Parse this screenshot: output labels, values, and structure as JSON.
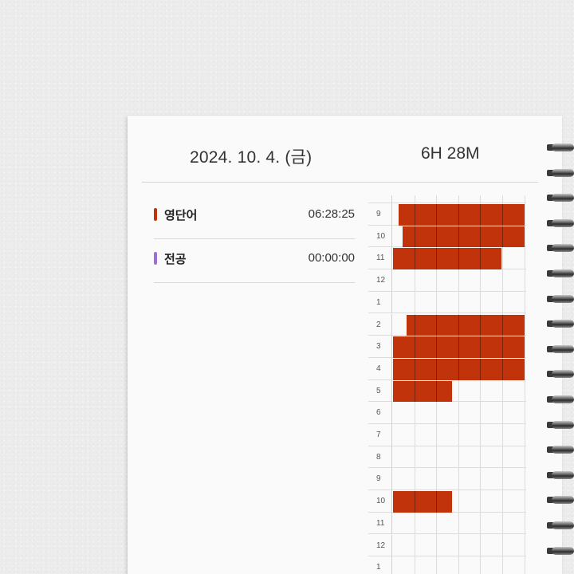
{
  "header": {
    "date": "2024. 10. 4. (금)",
    "total": "6H 28M"
  },
  "subjects": [
    {
      "name": "영단어",
      "time": "06:28:25",
      "color": "#c1340b"
    },
    {
      "name": "전공",
      "time": "00:00:00",
      "color": "#9b6fd6"
    }
  ],
  "timeline": {
    "hour_labels": [
      "9",
      "10",
      "11",
      "12",
      "1",
      "2",
      "3",
      "4",
      "5",
      "6",
      "7",
      "8",
      "9",
      "10",
      "11",
      "12",
      "1"
    ],
    "study_color": "#c1340b",
    "filled_fraction_per_hour": [
      {
        "label": "10",
        "from": 0.07,
        "to": 1.0
      },
      {
        "label": "11",
        "from": 0.0,
        "to": 0.83
      },
      {
        "label": "2",
        "from": 0.1,
        "to": 1.0
      },
      {
        "label": "3",
        "from": 0.0,
        "to": 1.0
      },
      {
        "label": "4",
        "from": 0.0,
        "to": 1.0
      },
      {
        "label": "5",
        "from": 0.0,
        "to": 0.45
      },
      {
        "label": "9",
        "from": 0.04,
        "to": 1.0
      },
      {
        "label": "10",
        "from": 0.0,
        "to": 0.45
      }
    ]
  }
}
